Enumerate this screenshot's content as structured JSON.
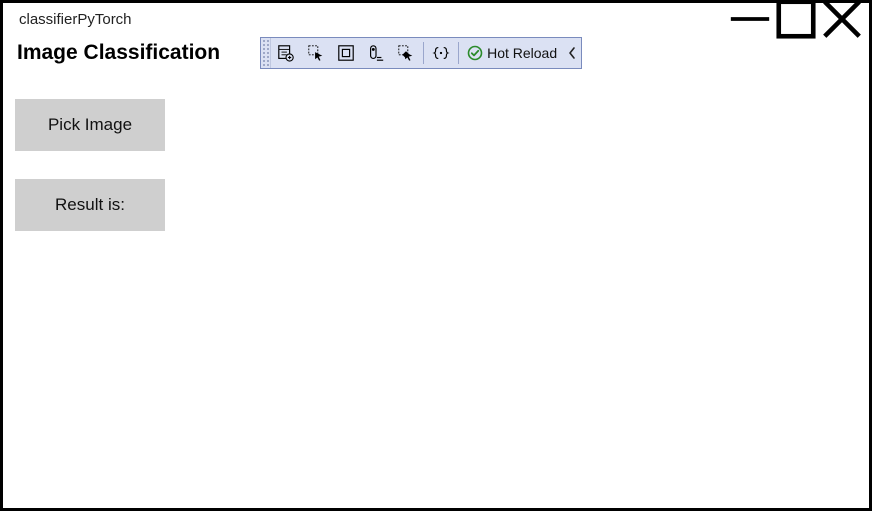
{
  "window": {
    "title": "classifierPyTorch"
  },
  "header": {
    "page_title": "Image Classification"
  },
  "toolbar": {
    "hot_reload_label": "Hot Reload"
  },
  "buttons": {
    "pick_image": "Pick Image"
  },
  "result": {
    "label": "Result is:"
  }
}
